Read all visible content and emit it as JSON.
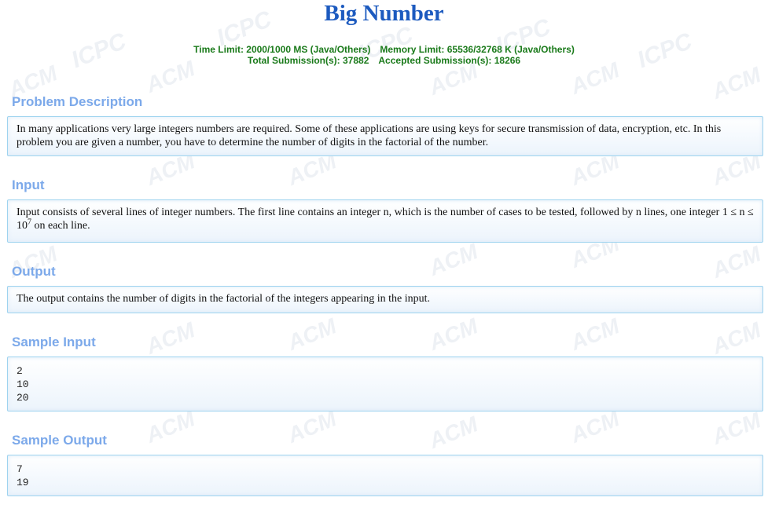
{
  "title": "Big Number",
  "limits": {
    "time": "Time Limit: 2000/1000 MS (Java/Others)",
    "memory": "Memory Limit: 65536/32768 K (Java/Others)",
    "total": "Total Submission(s): 37882",
    "accepted": "Accepted Submission(s): 18266"
  },
  "watermark": {
    "acm": "ACM",
    "icpc": "ICPC"
  },
  "sections": {
    "description": {
      "heading": "Problem Description",
      "text": "In many applications very large integers numbers are required. Some of these applications are using keys for secure transmission of data, encryption, etc. In this problem you are given a number, you have to determine the number of digits in the factorial of the number."
    },
    "input": {
      "heading": "Input",
      "text_before": "Input consists of several lines of integer numbers. The first line contains an integer n, which is the number of cases to be tested, followed by n lines, one integer 1 ≤ n ≤ 10",
      "superscript": "7",
      "text_after": " on each line."
    },
    "output": {
      "heading": "Output",
      "text": "The output contains the number of digits in the factorial of the integers appearing in the input."
    },
    "sample_input": {
      "heading": "Sample Input",
      "text": "2\n10\n20"
    },
    "sample_output": {
      "heading": "Sample Output",
      "text": "7\n19"
    }
  }
}
